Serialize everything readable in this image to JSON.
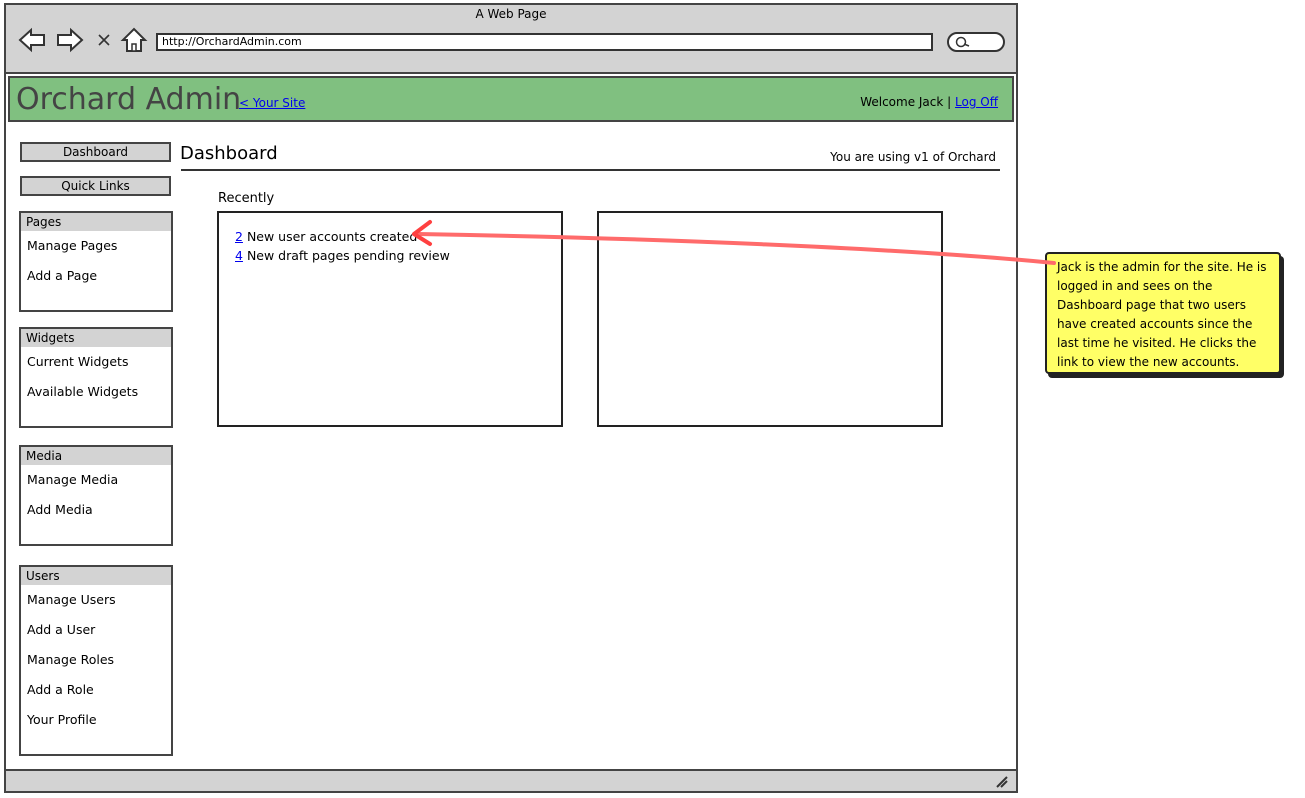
{
  "window": {
    "title": "A Web Page"
  },
  "addressbar": {
    "url": "http://OrchardAdmin.com"
  },
  "header": {
    "logo": "Orchard Admin",
    "site_link": "< Your Site",
    "welcome": "Welcome Jack |",
    "logoff": "Log Off",
    "background": "#80c080"
  },
  "sidebar": {
    "buttons": [
      "Dashboard",
      "Quick Links"
    ],
    "sections": [
      {
        "title": "Pages",
        "items": [
          "Manage Pages",
          "Add a Page"
        ]
      },
      {
        "title": "Widgets",
        "items": [
          "Current Widgets",
          "Available Widgets"
        ]
      },
      {
        "title": "Media",
        "items": [
          "Manage Media",
          "Add Media"
        ]
      },
      {
        "title": "Users",
        "items": [
          "Manage Users",
          "Add a User",
          "Manage Roles",
          "Add a Role",
          "Your Profile"
        ]
      }
    ]
  },
  "main": {
    "title": "Dashboard",
    "version": "You are using v1 of Orchard",
    "recently_label": "Recently",
    "recent": [
      {
        "count": "2",
        "text": "New user accounts created"
      },
      {
        "count": "4",
        "text": "New draft pages pending review"
      }
    ]
  },
  "note": {
    "text": "Jack is the admin for the site. He is logged in and sees on the Dashboard page that two users have created accounts since the last time he visited. He clicks the link to view the new accounts.",
    "background": "#ffff66",
    "arrow_color": "#ff6b6b"
  }
}
